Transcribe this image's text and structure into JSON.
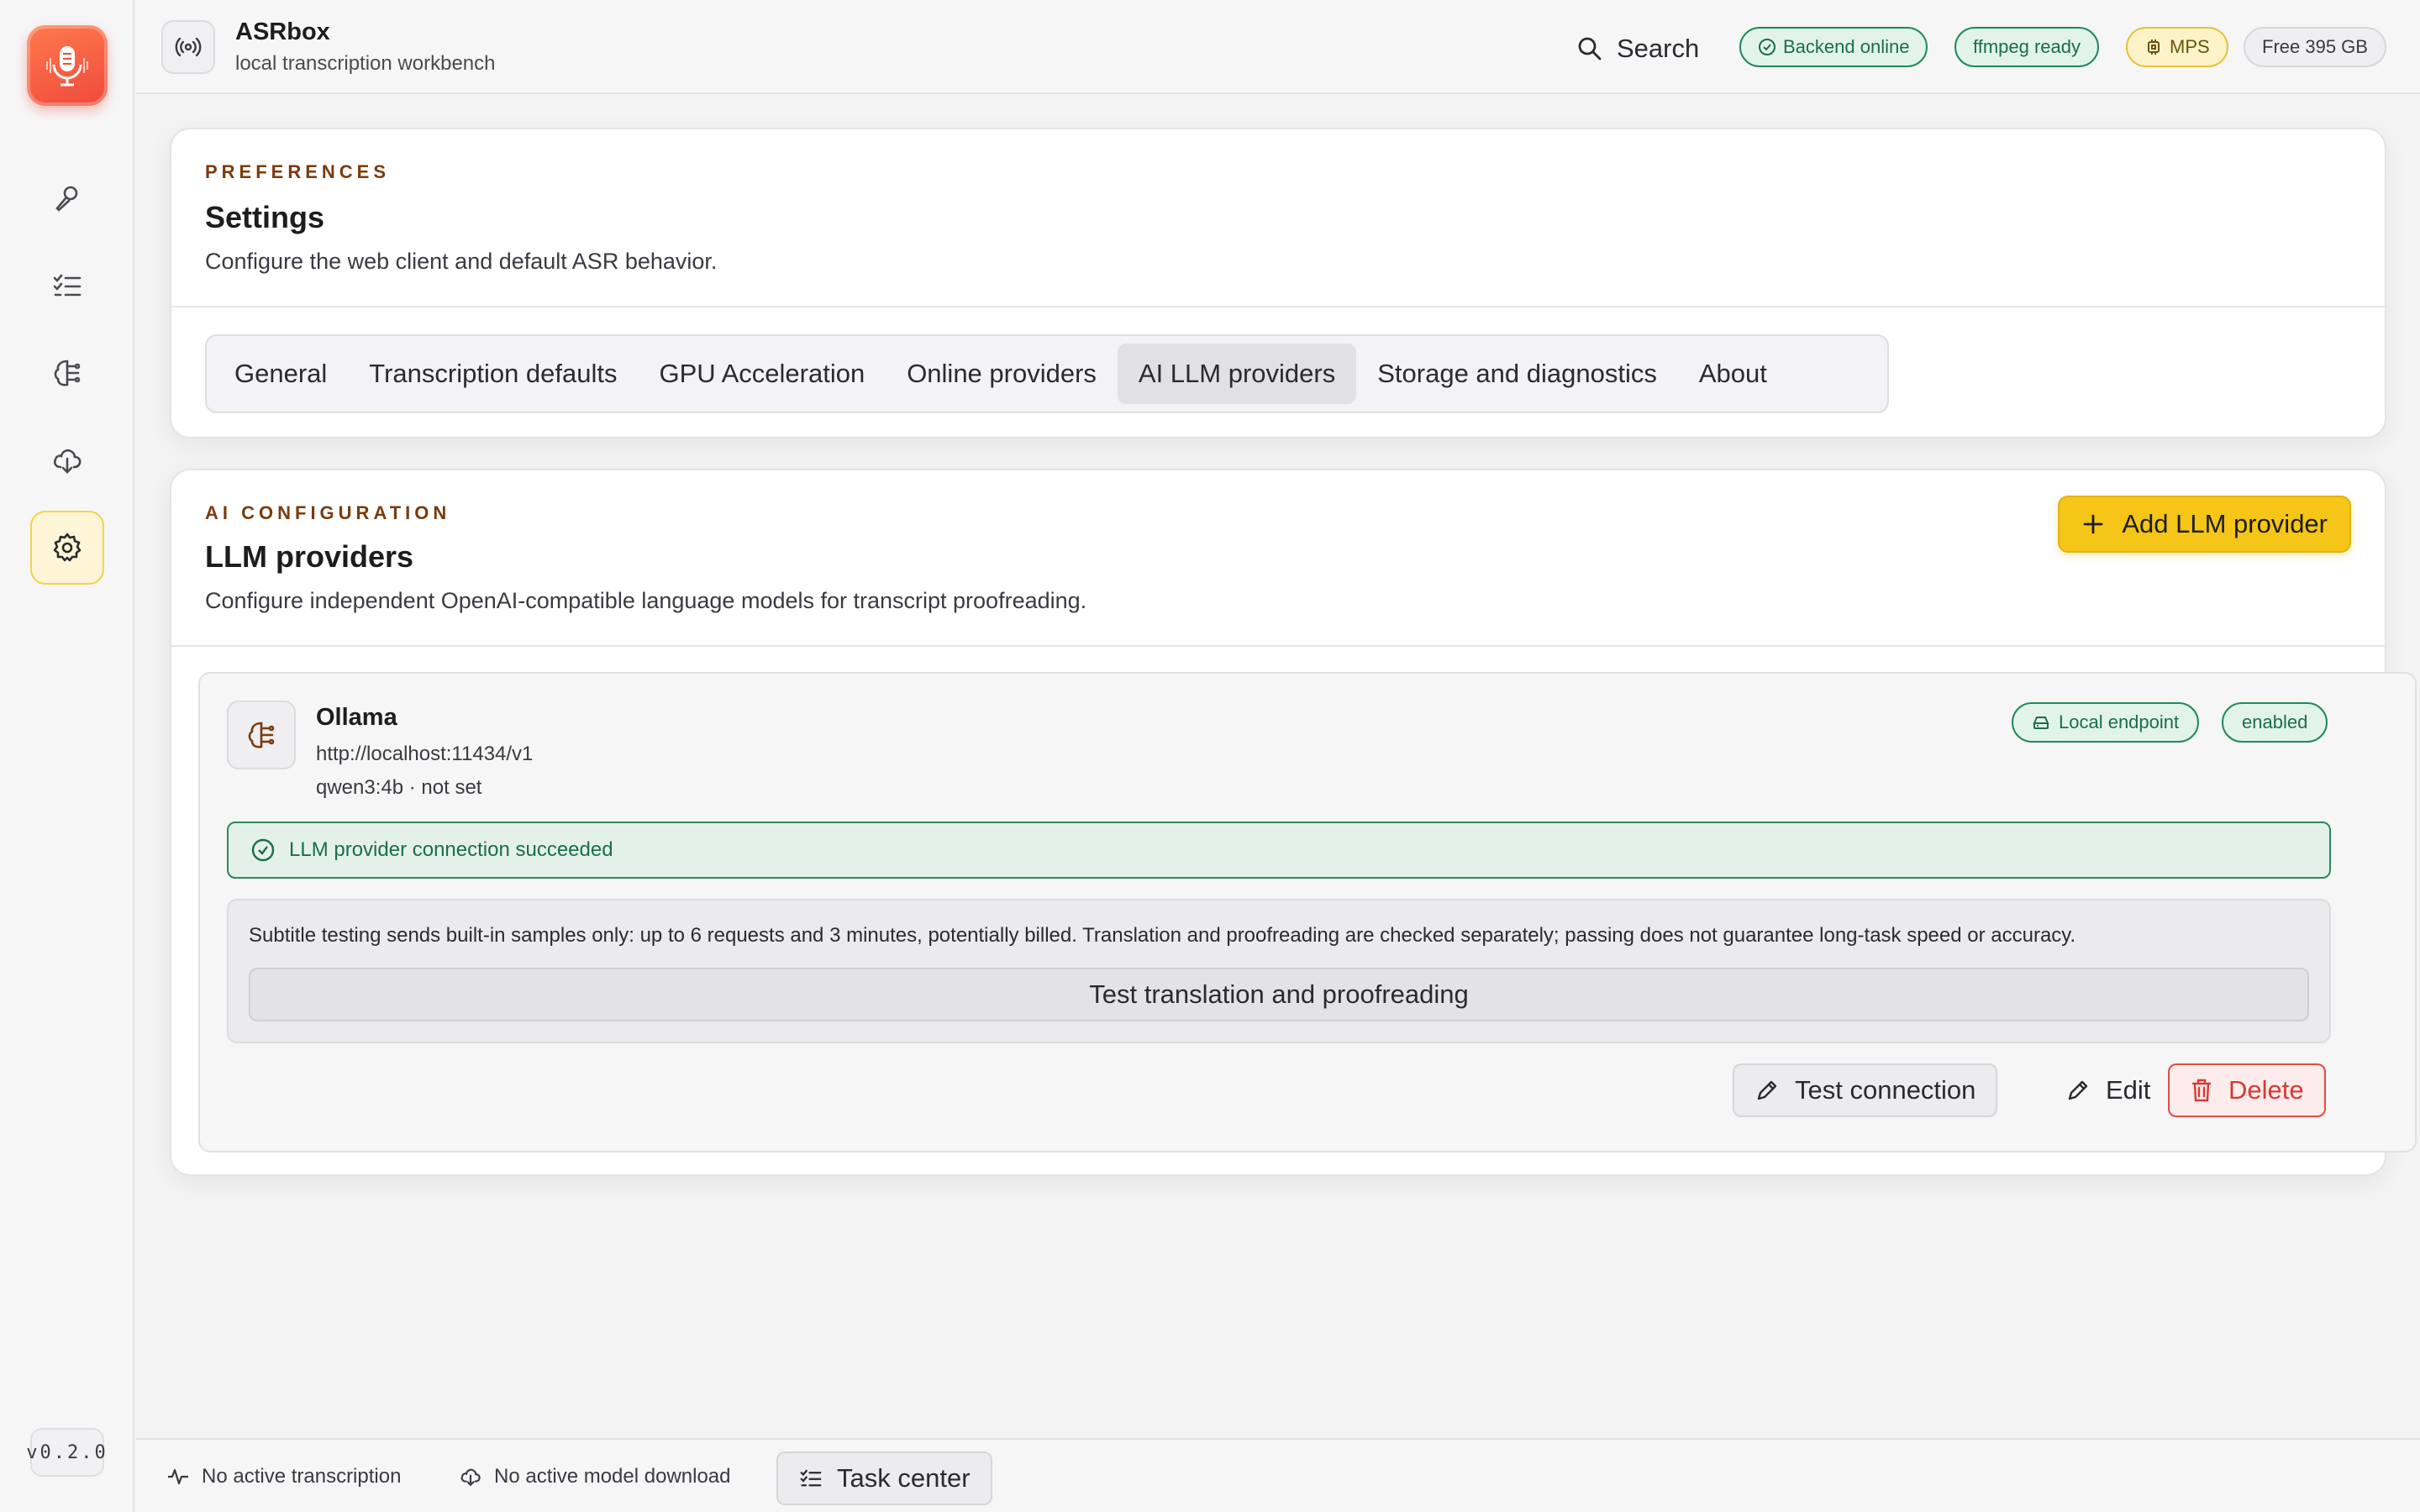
{
  "app": {
    "title": "ASRbox",
    "subtitle": "local transcription workbench",
    "version": "v0.2.0"
  },
  "sidebar": {
    "items": [
      {
        "name": "transcribe",
        "icon": "microphone-icon"
      },
      {
        "name": "tasks",
        "icon": "checklist-icon"
      },
      {
        "name": "models",
        "icon": "brain-icon"
      },
      {
        "name": "downloads",
        "icon": "cloud-download-icon"
      },
      {
        "name": "settings",
        "icon": "gear-icon",
        "active": true
      }
    ]
  },
  "topbar": {
    "search_label": "Search",
    "badges": {
      "backend": "Backend online",
      "ffmpeg": "ffmpeg ready",
      "device": "MPS",
      "storage": "Free 395 GB"
    }
  },
  "preferences": {
    "eyebrow": "PREFERENCES",
    "title": "Settings",
    "description": "Configure the web client and default ASR behavior.",
    "tabs": [
      "General",
      "Transcription defaults",
      "GPU Acceleration",
      "Online providers",
      "AI LLM providers",
      "Storage and diagnostics",
      "About"
    ],
    "active_tab": "AI LLM providers"
  },
  "llm": {
    "eyebrow": "AI CONFIGURATION",
    "title": "LLM providers",
    "description": "Configure independent OpenAI-compatible language models for transcript proofreading.",
    "add_button": "Add LLM provider",
    "provider": {
      "name": "Ollama",
      "url": "http://localhost:11434/v1",
      "model": "qwen3:4b · not set",
      "badge_endpoint": "Local endpoint",
      "badge_status": "enabled",
      "success_message": "LLM provider connection succeeded",
      "note": "Subtitle testing sends built-in samples only: up to 6 requests and 3 minutes, potentially billed. Translation and proofreading are checked separately; passing does not guarantee long-task speed or accuracy.",
      "test_tp_button": "Test translation and proofreading",
      "test_conn_button": "Test connection",
      "edit_button": "Edit",
      "delete_button": "Delete"
    }
  },
  "statusbar": {
    "transcription": "No active transcription",
    "download": "No active model download",
    "task_center": "Task center"
  },
  "colors": {
    "accent": "#f5c518",
    "success": "#1f8a5b",
    "danger": "#e34b45",
    "brand": "#ef4a3c"
  }
}
